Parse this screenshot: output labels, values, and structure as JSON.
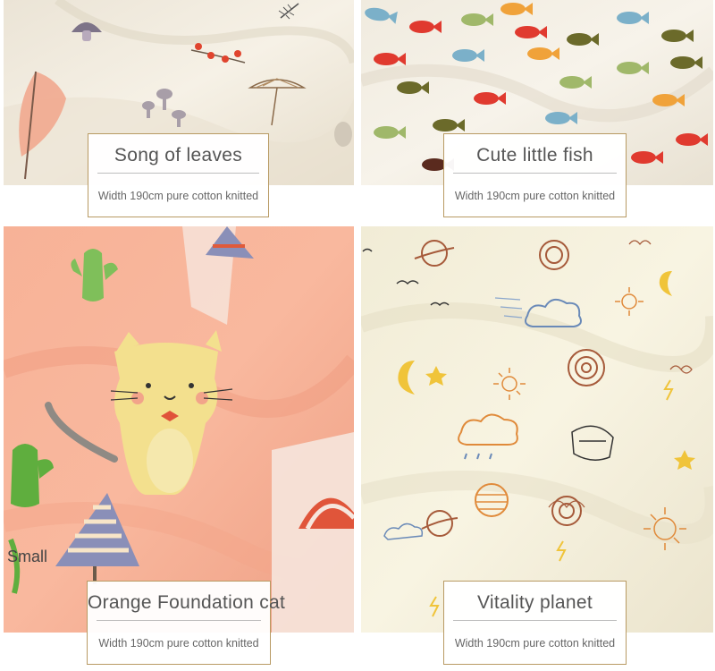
{
  "panels": [
    {
      "name": "Song of leaves",
      "title": "Song of leaves",
      "subtitle": "Width 190cm pure cotton knitted",
      "background": "#f3ede0",
      "motifs": [
        "mushroom-icon",
        "leaf-icon",
        "berry-branch-icon",
        "dandelion-icon"
      ]
    },
    {
      "name": "Cute little fish",
      "title": "Cute little fish",
      "subtitle": "Width 190cm pure cotton knitted",
      "background": "#f4efe4",
      "motifs": [
        "fish-icon"
      ],
      "fish_colors": [
        "#6b6a2a",
        "#e03a2f",
        "#7bb0c9",
        "#f0a23a",
        "#a0b86a",
        "#5a2a1e"
      ]
    },
    {
      "name": "Orange Foundation cat",
      "title": "Orange Foundation cat",
      "subtitle": "Width 190cm pure cotton knitted",
      "background": "#f6a98c",
      "motifs": [
        "cat-icon",
        "cactus-icon",
        "striped-tree-icon",
        "rainbow-icon"
      ],
      "extra_label": "Small"
    },
    {
      "name": "Vitality planet",
      "title": "Vitality planet",
      "subtitle": "Width 190cm pure cotton knitted",
      "background": "#f5f0dc",
      "motifs": [
        "planet-icon",
        "cloud-icon",
        "sun-icon",
        "moon-icon",
        "star-icon",
        "lightning-icon"
      ]
    }
  ],
  "colors": {
    "card_border": "#b89a63",
    "title_text": "#555555",
    "subtitle_text": "#666666"
  }
}
